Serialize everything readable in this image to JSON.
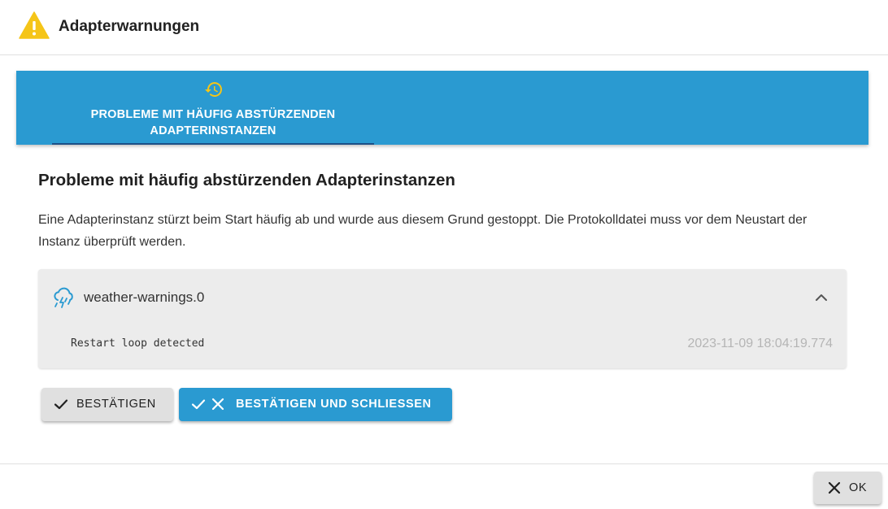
{
  "header": {
    "title": "Adapterwarnungen",
    "icon": "warning-icon",
    "icon_color": "#f5c518"
  },
  "tabs": [
    {
      "label": "PROBLEME MIT HÄUFIG ABSTÜRZENDEN ADAPTERINSTANZEN",
      "icon": "restart-history-icon",
      "icon_color": "#f5c518",
      "selected": true
    }
  ],
  "main": {
    "section_title": "Probleme mit häufig abstürzenden Adapterinstanzen",
    "description": "Eine Adapterinstanz stürzt beim Start häufig ab und wurde aus diesem Grund gestoppt. Die Protokolldatei muss vor dem Neustart der Instanz überprüft werden.",
    "instance": {
      "name": "weather-warnings.0",
      "icon": "weather-cloud-icon",
      "expanded": true,
      "message": "Restart loop detected",
      "timestamp": "2023-11-09 18:04:19.774"
    },
    "actions": {
      "confirm_label": "BESTÄTIGEN",
      "confirm_close_label": "BESTÄTIGEN UND SCHLIESSEN"
    }
  },
  "footer": {
    "ok_label": "OK"
  },
  "colors": {
    "accent": "#2a9ad1",
    "tab_indicator": "#1c4f86",
    "button_grey": "#e0e0e0",
    "panel_grey": "#ececec"
  }
}
